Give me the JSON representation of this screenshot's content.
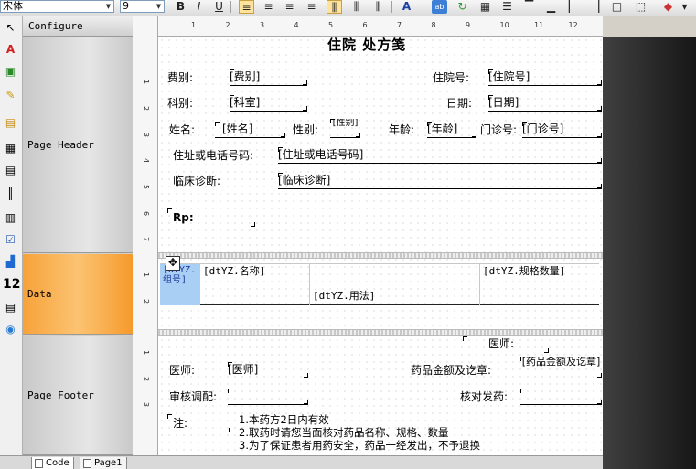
{
  "toolbar": {
    "font_name": "宋体",
    "font_size": "9",
    "bold": "B",
    "italic": "I",
    "underline": "U"
  },
  "band_panel": {
    "configure": "Configure",
    "page_header": "Page Header",
    "data": "Data",
    "page_footer": "Page Footer"
  },
  "hruler_numbers": [
    "1",
    "2",
    "3",
    "4",
    "5",
    "6",
    "7",
    "8",
    "9",
    "10",
    "11",
    "12"
  ],
  "vruler_numbers": [
    "1",
    "2",
    "3",
    "4",
    "5",
    "6",
    "7",
    "1",
    "2",
    "1",
    "2",
    "3"
  ],
  "tabs": {
    "code": "Code",
    "page1": "Page1"
  },
  "header": {
    "title": "住院 处方笺",
    "category_label": "费别:",
    "category_field": "[费别]",
    "admission_label": "住院号:",
    "admission_field": "[住院号]",
    "dept_label": "科别:",
    "dept_field": "[科室]",
    "date_label": "日期:",
    "date_field": "[日期]",
    "name_label": "姓名:",
    "name_field": "[姓名]",
    "sex_label": "性别:",
    "sex_field": "[性别]",
    "age_label": "年龄:",
    "age_field": "[年龄]",
    "clinic_label": "门诊号:",
    "clinic_field": "[门诊号]",
    "address_label": "住址或电话号码:",
    "address_field": "[住址或电话号码]",
    "diagnosis_label": "临床诊断:",
    "diagnosis_field": "[临床诊断]",
    "rp_label": "Rp:"
  },
  "data_band": {
    "group_no": "[dtYZ.组号]",
    "med_name": "[dtYZ.名称]",
    "usage": "[dtYZ.用法]",
    "spec_qty": "[dtYZ.规格数量]"
  },
  "footer": {
    "doctor_top_label": "医师:",
    "doctor_label": "医师:",
    "doctor_field": "[医师]",
    "amount_label": "药品金额及讫章:",
    "amount_field": "[药品金额及讫章]",
    "review_label": "审核调配:",
    "check_label": "核对发药:",
    "note_label": "注:",
    "note_lines": [
      "1.本药方2日内有效",
      "2.取药时请您当面核对药品名称、规格、数量",
      "3.为了保证患者用药安全，药品一经发出，不予退换"
    ]
  }
}
